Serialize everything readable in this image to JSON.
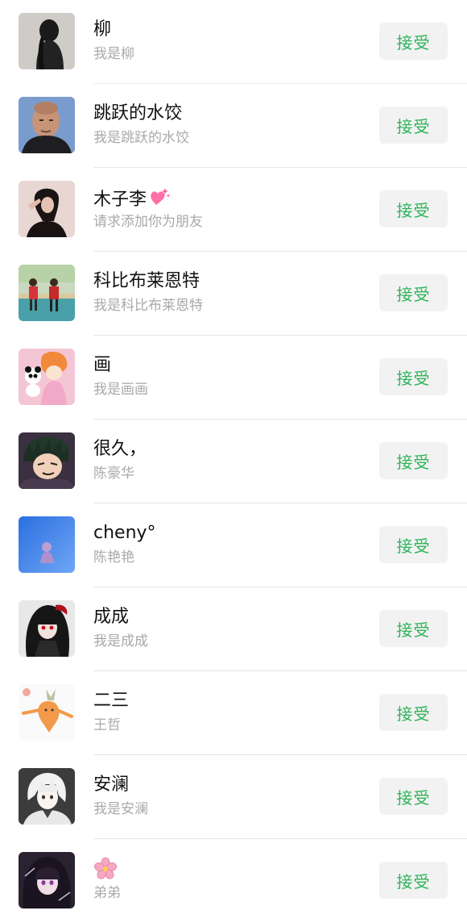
{
  "requests": [
    {
      "name": "柳",
      "message": "我是柳",
      "accept_label": "接受",
      "avatar_icon": "avatar-dark-hair-girl-icon"
    },
    {
      "name": "跳跃的水饺",
      "message": "我是跳跃的水饺",
      "accept_label": "接受",
      "avatar_icon": "avatar-bald-man-icon"
    },
    {
      "name": "木子李",
      "message": "请求添加你为朋友",
      "accept_label": "接受",
      "avatar_icon": "avatar-woman-pose-icon",
      "name_icon": "sparkling-heart-icon"
    },
    {
      "name": "科比布莱恩特",
      "message": "我是科比布莱恩特",
      "accept_label": "接受",
      "avatar_icon": "avatar-basketball-court-icon"
    },
    {
      "name": "画",
      "message": "我是画画",
      "accept_label": "接受",
      "avatar_icon": "avatar-cartoon-girl-panda-icon"
    },
    {
      "name": "很久，",
      "message": "陈豪华",
      "accept_label": "接受",
      "avatar_icon": "avatar-anime-boy-icon"
    },
    {
      "name": "cheny°",
      "message": "陈艳艳",
      "accept_label": "接受",
      "avatar_icon": "avatar-blue-silhouette-icon"
    },
    {
      "name": "成成",
      "message": "我是成成",
      "accept_label": "接受",
      "avatar_icon": "avatar-anime-dark-icon"
    },
    {
      "name": "二三",
      "message": "王哲",
      "accept_label": "接受",
      "avatar_icon": "avatar-carrot-cartoon-icon"
    },
    {
      "name": "安澜",
      "message": "我是安澜",
      "accept_label": "接受",
      "avatar_icon": "avatar-anime-white-hair-icon"
    },
    {
      "name": "",
      "message": "弟弟",
      "accept_label": "接受",
      "avatar_icon": "avatar-anime-purple-girl-icon",
      "name_icon": "cherry-blossom-icon"
    }
  ],
  "colors": {
    "accept_text": "#2fb35a",
    "accept_bg": "#f2f2f2",
    "name_text": "#111111",
    "message_text": "#a9a9a9",
    "divider": "#e6e6e6"
  }
}
